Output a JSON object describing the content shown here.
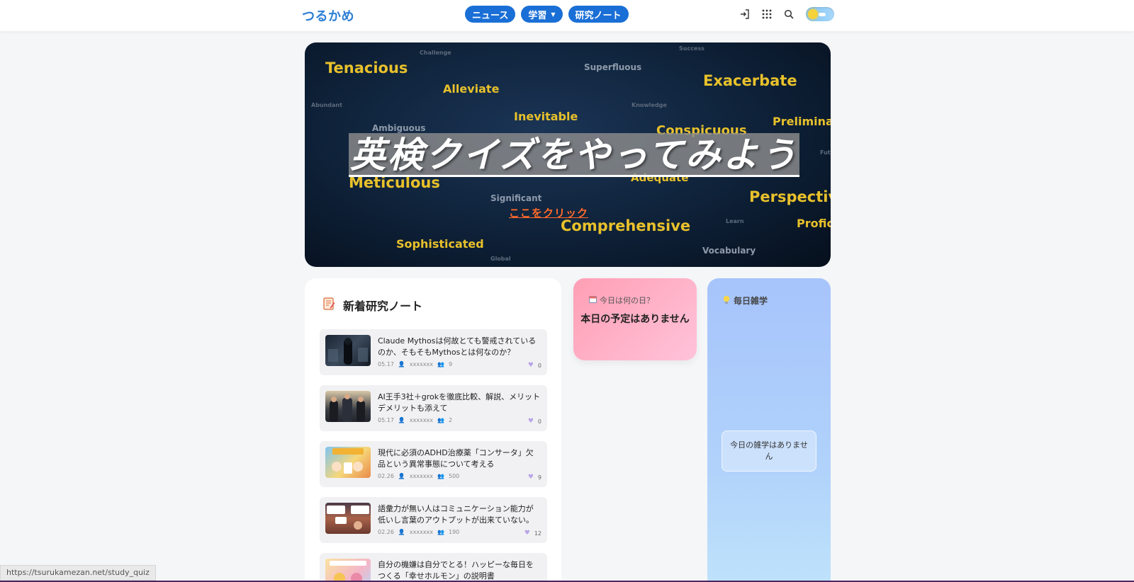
{
  "header": {
    "logo": "つるかめ",
    "nav": [
      {
        "label": "ニュース",
        "has_caret": false
      },
      {
        "label": "学習",
        "has_caret": true
      },
      {
        "label": "研究ノート",
        "has_caret": false
      }
    ],
    "icons": [
      "login-icon",
      "apps-grid-icon",
      "search-icon",
      "theme-toggle"
    ]
  },
  "hero": {
    "title": "英検クイズをやってみよう",
    "link": "ここをクリック",
    "words": [
      "Tenacious",
      "Challenge",
      "Superfluous",
      "Success",
      "Exacerbate",
      "Alleviate",
      "Abundant",
      "Knowledge",
      "Inevitable",
      "Preliminary",
      "Ambiguous",
      "Conspicuous",
      "Fut",
      "Meticulous",
      "Adequate",
      "Significant",
      "Perspective",
      "Learn",
      "Proficient",
      "Comprehensive",
      "Sophisticated",
      "Global",
      "Vocabulary"
    ]
  },
  "notes": {
    "title": "新着研究ノート",
    "items": [
      {
        "title": "Claude Mythosは何故とても警戒されているのか、そもそもMythosとは何なのか？",
        "date": "05.17",
        "author": "xxxxxxx",
        "views": "9",
        "likes": "0"
      },
      {
        "title": "AI王手3社＋grokを徹底比較、解説、メリットデメリットも添えて",
        "date": "05.17",
        "author": "xxxxxxx",
        "views": "2",
        "likes": "0"
      },
      {
        "title": "現代に必須のADHD治療薬「コンサータ」欠品という異常事態について考える",
        "date": "02.26",
        "author": "xxxxxxx",
        "views": "500",
        "likes": "9"
      },
      {
        "title": "語彙力が無い人はコミュニケーション能力が低いし言葉のアウトプットが出来ていない。現代社…",
        "date": "02.26",
        "author": "xxxxxxx",
        "views": "190",
        "likes": "12"
      },
      {
        "title": "自分の機嫌は自分でとる！ハッピーな毎日をつくる「幸せホルモン」の説明書",
        "date": "",
        "author": "",
        "views": "",
        "likes": ""
      }
    ]
  },
  "today": {
    "label": "今日は何の日？",
    "text": "本日の予定はありません"
  },
  "trivia": {
    "label": "毎日雑学",
    "text": "今日の雑学はありません"
  },
  "status_url": "https://tsurukamezan.net/study_quiz",
  "colors": {
    "accent": "#1a6fd6",
    "logo": "#2e7fd6",
    "hero_word": "#e8c12b",
    "hero_link": "#ff6a2a"
  }
}
